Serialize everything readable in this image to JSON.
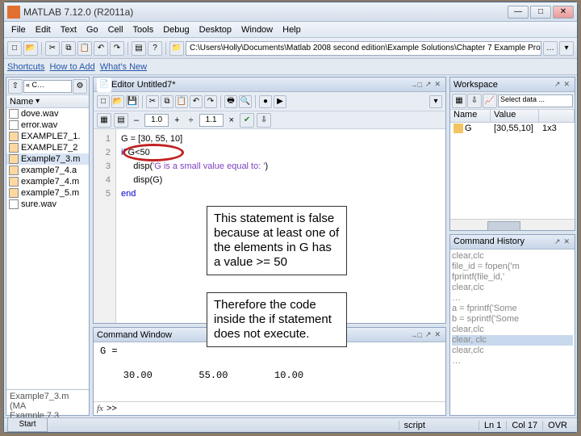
{
  "title": "MATLAB 7.12.0 (R2011a)",
  "menu": [
    "File",
    "Edit",
    "Text",
    "Go",
    "Cell",
    "Tools",
    "Debug",
    "Desktop",
    "Window",
    "Help"
  ],
  "path": "C:\\Users\\Holly\\Documents\\Matlab 2008   second edition\\Example Solutions\\Chapter 7 Example Problems",
  "shortcuts": {
    "a": "Shortcuts",
    "b": "How to Add",
    "c": "What's New"
  },
  "curfolder": {
    "header": "Name",
    "files": [
      "dove.wav",
      "error.wav",
      "EXAMPLE7_1.",
      "EXAMPLE7_2",
      "Example7_3.m",
      "example7_4.a",
      "example7_4.m",
      "example7_5.m",
      "sure.wav"
    ],
    "sel_idx": 4,
    "detail_title": "Example7_3.m  (MA",
    "detail_sub": "Example 7.3"
  },
  "editor": {
    "title": "Editor  Untitled7*",
    "numbox1": "1.0",
    "numbox2": "1.1",
    "lines": [
      "1",
      "2",
      "3",
      "4",
      "5"
    ],
    "c1": "G = [30, 55, 10]",
    "c2a": "if",
    "c2b": " G<50",
    "c3a": "     disp(",
    "c3b": "'G is a small value equal to: '",
    "c3c": ")",
    "c4": "     disp(G)",
    "c5": "end"
  },
  "comment1": "This statement is false because at least one of the elements in G has a value >= 50",
  "comment2": "Therefore the code inside the if statement does not execute.",
  "cmdwin": {
    "title": "Command Window",
    "out": "G =\n\n    30.00        55.00        10.00",
    "prompt": ">>"
  },
  "workspace": {
    "title": "Workspace",
    "stack": "Select data ...",
    "h1": "Name",
    "h2": "Value",
    "var": "G",
    "val": "[30,55,10]",
    "dim": "1x3"
  },
  "cmdhist": {
    "title": "Command History",
    "items": [
      "clear,clc",
      "file_id = fopen('m",
      "fprintf(file_id,'",
      "clear,clc",
      "…",
      "a = fprintf('Some",
      "b = sprintf('Some",
      "clear,clc",
      "clear, clc",
      "clear,clc",
      "…"
    ]
  },
  "status": {
    "scr": "script",
    "ln": "Ln  1",
    "col": "Col  17",
    "ovr": "OVR"
  },
  "start": "Start"
}
